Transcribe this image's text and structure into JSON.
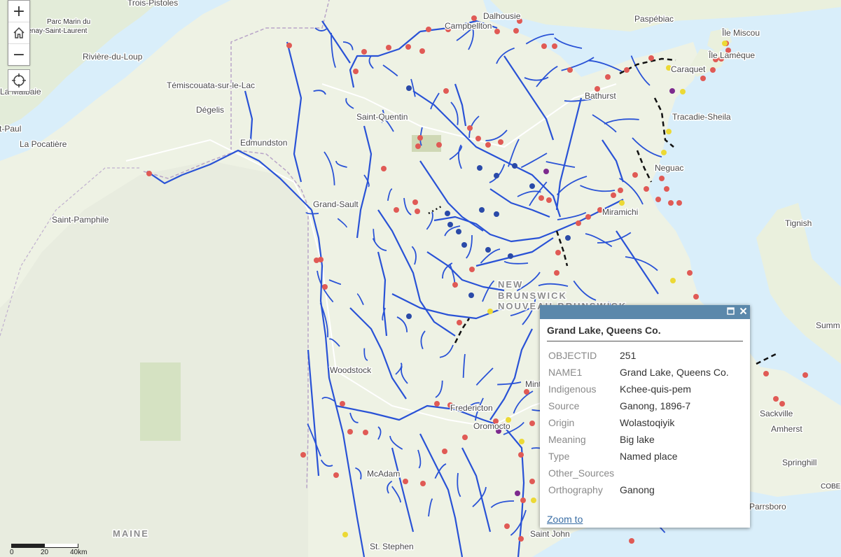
{
  "map": {
    "places": [
      {
        "name": "Trois-Pistoles"
      },
      {
        "name": "Parc Marin du"
      },
      {
        "name": "Saguenay-Saint-Laurent"
      },
      {
        "name": "Dalhousie"
      },
      {
        "name": "Campbellton"
      },
      {
        "name": "Paspébiac"
      },
      {
        "name": "Île Miscou"
      },
      {
        "name": "Île Lamèque"
      },
      {
        "name": "Caraquet"
      },
      {
        "name": "Rivière-du-Loup"
      },
      {
        "name": "La Malbaie"
      },
      {
        "name": "Témiscouata-sur-le-Lac"
      },
      {
        "name": "Dégelis"
      },
      {
        "name": "Saint-Quentin"
      },
      {
        "name": "Bathurst"
      },
      {
        "name": "Tracadie-Sheila"
      },
      {
        "name": "Saint-Paul"
      },
      {
        "name": "La Pocatière"
      },
      {
        "name": "Edmundston"
      },
      {
        "name": "Neguac"
      },
      {
        "name": "Grand-Sault"
      },
      {
        "name": "Miramichi"
      },
      {
        "name": "Saint-Pamphile"
      },
      {
        "name": "Tignish"
      },
      {
        "name": "NEW"
      },
      {
        "name": "BRUNSWICK"
      },
      {
        "name": "NOUVEAU-BRUNSWICK"
      },
      {
        "name": "Summ"
      },
      {
        "name": "Woodstock"
      },
      {
        "name": "Minto"
      },
      {
        "name": "Fredericton"
      },
      {
        "name": "Oromocto"
      },
      {
        "name": "Sackville"
      },
      {
        "name": "Amherst"
      },
      {
        "name": "Springhill"
      },
      {
        "name": "McAdam"
      },
      {
        "name": "MAINE"
      },
      {
        "name": "Parrsboro"
      },
      {
        "name": "Saint John"
      },
      {
        "name": "St. Stephen"
      },
      {
        "name": "COBEQ"
      }
    ]
  },
  "controls": {
    "zoom_in": "+",
    "zoom_out": "−",
    "home_icon": "home-icon",
    "locate_icon": "locate-icon"
  },
  "scalebar": {
    "labels": [
      "0",
      "20",
      "40km"
    ]
  },
  "popup": {
    "title": "Grand Lake, Queens Co.",
    "fields": [
      {
        "name": "OBJECTID",
        "value": "251"
      },
      {
        "name": "NAME1",
        "value": "Grand Lake, Queens Co."
      },
      {
        "name": "Indigenous",
        "value": "Kchee-quis-pem"
      },
      {
        "name": "Source",
        "value": "Ganong, 1896-7"
      },
      {
        "name": "Origin",
        "value": "Wolastoqiyik"
      },
      {
        "name": "Meaning",
        "value": "Big lake"
      },
      {
        "name": "Type",
        "value": "Named place"
      },
      {
        "name": "Other_Sources",
        "value": ""
      },
      {
        "name": "Orthography",
        "value": "Ganong"
      }
    ],
    "zoom_to": "Zoom to",
    "maximize_icon": "maximize-icon",
    "close_icon": "close-icon"
  },
  "colors": {
    "water": "#d9eefa",
    "land": "#edf2e1",
    "river": "#2952d6",
    "point_red": "#e05a55",
    "point_blue": "#2a4aa8",
    "point_yellow": "#ecd935",
    "point_purple": "#7d2a8e",
    "popup_header": "#5b88ab"
  }
}
